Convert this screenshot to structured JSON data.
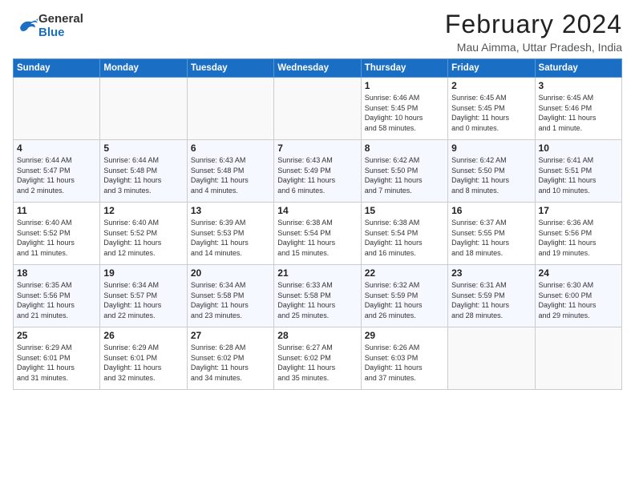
{
  "header": {
    "logo_general": "General",
    "logo_blue": "Blue",
    "month_title": "February 2024",
    "location": "Mau Aimma, Uttar Pradesh, India"
  },
  "weekdays": [
    "Sunday",
    "Monday",
    "Tuesday",
    "Wednesday",
    "Thursday",
    "Friday",
    "Saturday"
  ],
  "weeks": [
    [
      {
        "day": "",
        "info": ""
      },
      {
        "day": "",
        "info": ""
      },
      {
        "day": "",
        "info": ""
      },
      {
        "day": "",
        "info": ""
      },
      {
        "day": "1",
        "info": "Sunrise: 6:46 AM\nSunset: 5:45 PM\nDaylight: 10 hours\nand 58 minutes."
      },
      {
        "day": "2",
        "info": "Sunrise: 6:45 AM\nSunset: 5:45 PM\nDaylight: 11 hours\nand 0 minutes."
      },
      {
        "day": "3",
        "info": "Sunrise: 6:45 AM\nSunset: 5:46 PM\nDaylight: 11 hours\nand 1 minute."
      }
    ],
    [
      {
        "day": "4",
        "info": "Sunrise: 6:44 AM\nSunset: 5:47 PM\nDaylight: 11 hours\nand 2 minutes."
      },
      {
        "day": "5",
        "info": "Sunrise: 6:44 AM\nSunset: 5:48 PM\nDaylight: 11 hours\nand 3 minutes."
      },
      {
        "day": "6",
        "info": "Sunrise: 6:43 AM\nSunset: 5:48 PM\nDaylight: 11 hours\nand 4 minutes."
      },
      {
        "day": "7",
        "info": "Sunrise: 6:43 AM\nSunset: 5:49 PM\nDaylight: 11 hours\nand 6 minutes."
      },
      {
        "day": "8",
        "info": "Sunrise: 6:42 AM\nSunset: 5:50 PM\nDaylight: 11 hours\nand 7 minutes."
      },
      {
        "day": "9",
        "info": "Sunrise: 6:42 AM\nSunset: 5:50 PM\nDaylight: 11 hours\nand 8 minutes."
      },
      {
        "day": "10",
        "info": "Sunrise: 6:41 AM\nSunset: 5:51 PM\nDaylight: 11 hours\nand 10 minutes."
      }
    ],
    [
      {
        "day": "11",
        "info": "Sunrise: 6:40 AM\nSunset: 5:52 PM\nDaylight: 11 hours\nand 11 minutes."
      },
      {
        "day": "12",
        "info": "Sunrise: 6:40 AM\nSunset: 5:52 PM\nDaylight: 11 hours\nand 12 minutes."
      },
      {
        "day": "13",
        "info": "Sunrise: 6:39 AM\nSunset: 5:53 PM\nDaylight: 11 hours\nand 14 minutes."
      },
      {
        "day": "14",
        "info": "Sunrise: 6:38 AM\nSunset: 5:54 PM\nDaylight: 11 hours\nand 15 minutes."
      },
      {
        "day": "15",
        "info": "Sunrise: 6:38 AM\nSunset: 5:54 PM\nDaylight: 11 hours\nand 16 minutes."
      },
      {
        "day": "16",
        "info": "Sunrise: 6:37 AM\nSunset: 5:55 PM\nDaylight: 11 hours\nand 18 minutes."
      },
      {
        "day": "17",
        "info": "Sunrise: 6:36 AM\nSunset: 5:56 PM\nDaylight: 11 hours\nand 19 minutes."
      }
    ],
    [
      {
        "day": "18",
        "info": "Sunrise: 6:35 AM\nSunset: 5:56 PM\nDaylight: 11 hours\nand 21 minutes."
      },
      {
        "day": "19",
        "info": "Sunrise: 6:34 AM\nSunset: 5:57 PM\nDaylight: 11 hours\nand 22 minutes."
      },
      {
        "day": "20",
        "info": "Sunrise: 6:34 AM\nSunset: 5:58 PM\nDaylight: 11 hours\nand 23 minutes."
      },
      {
        "day": "21",
        "info": "Sunrise: 6:33 AM\nSunset: 5:58 PM\nDaylight: 11 hours\nand 25 minutes."
      },
      {
        "day": "22",
        "info": "Sunrise: 6:32 AM\nSunset: 5:59 PM\nDaylight: 11 hours\nand 26 minutes."
      },
      {
        "day": "23",
        "info": "Sunrise: 6:31 AM\nSunset: 5:59 PM\nDaylight: 11 hours\nand 28 minutes."
      },
      {
        "day": "24",
        "info": "Sunrise: 6:30 AM\nSunset: 6:00 PM\nDaylight: 11 hours\nand 29 minutes."
      }
    ],
    [
      {
        "day": "25",
        "info": "Sunrise: 6:29 AM\nSunset: 6:01 PM\nDaylight: 11 hours\nand 31 minutes."
      },
      {
        "day": "26",
        "info": "Sunrise: 6:29 AM\nSunset: 6:01 PM\nDaylight: 11 hours\nand 32 minutes."
      },
      {
        "day": "27",
        "info": "Sunrise: 6:28 AM\nSunset: 6:02 PM\nDaylight: 11 hours\nand 34 minutes."
      },
      {
        "day": "28",
        "info": "Sunrise: 6:27 AM\nSunset: 6:02 PM\nDaylight: 11 hours\nand 35 minutes."
      },
      {
        "day": "29",
        "info": "Sunrise: 6:26 AM\nSunset: 6:03 PM\nDaylight: 11 hours\nand 37 minutes."
      },
      {
        "day": "",
        "info": ""
      },
      {
        "day": "",
        "info": ""
      }
    ]
  ]
}
